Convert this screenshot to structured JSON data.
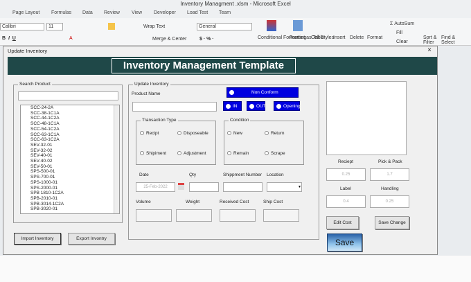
{
  "window": {
    "title": "Inventory Managment .xlsm - Microsoft Excel"
  },
  "menu": [
    "Page Layout",
    "Formulas",
    "Data",
    "Review",
    "View",
    "Developer",
    "Load Test",
    "Team"
  ],
  "ribbon": {
    "font": "Calibri",
    "size": "11",
    "wrap_text": "Wrap Text",
    "merge_center": "Merge & Center",
    "number_format": "General",
    "conditional": "Conditional Formatting",
    "format_table": "Format as Table",
    "cell_styles": "Cell Styles",
    "insert": "Insert",
    "delete": "Delete",
    "format": "Format",
    "autosum": "AutoSum",
    "fill": "Fill",
    "clear": "Clear",
    "sort_filter": "Sort & Filter",
    "find_select": "Find & Select"
  },
  "dialog": {
    "title": "Update Inventory",
    "close": "×",
    "banner": "Inventory Management Template",
    "search": {
      "label": "Search Product",
      "value": "",
      "items": [
        "SCC-24-2A",
        "SCC-38-1C1A",
        "SCC-44-1C2A",
        "SCC-48-1C1A",
        "SCC-54-1C2A",
        "SCC-63-1C1A",
        "SCC-63-1C2A",
        "SEV-32-01",
        "SEV-32-02",
        "SEV-40-01",
        "SEV-40-02",
        "SEV-50-01",
        "SPS-500-01",
        "SPS-700-01",
        "SPS-1000-01",
        "SPS-2000-01",
        "SPB 1810-1C2A",
        "SPB-2010-01",
        "SPB-3014-1C2A",
        "SPB-3020-01"
      ]
    },
    "import": "Import Inventory",
    "export": "Export Invontry",
    "update": {
      "label": "Update Inventory",
      "product_name": "Product Name",
      "non_conform": "Non Conform",
      "in": "IN",
      "out": "OUT",
      "opening": "Opening",
      "transaction": {
        "label": "Transaction Type",
        "options": [
          "Recipt",
          "Disposeable",
          "Shipiment",
          "Adjustment"
        ]
      },
      "condition": {
        "label": "Condition",
        "options": [
          "New",
          "Return",
          "Remain",
          "Scrape"
        ]
      },
      "date": "Date",
      "date_value": "25-Feb-2022",
      "qty": "Qty",
      "shipment": "Shippment Number",
      "location": "Location",
      "volume": "Volume",
      "weight": "Weight",
      "received_cost": "Received Cost",
      "ship_cost": "Ship Cost"
    },
    "costs": {
      "receipt": "Reciept",
      "receipt_v": "0.25",
      "pick": "Pick & Pack",
      "pick_v": "1.7",
      "label": "Label",
      "label_v": "0.4",
      "handling": "Handling",
      "handling_v": "0.25"
    },
    "edit_cost": "Edit Cost",
    "save_change": "Save Change",
    "save": "Save"
  }
}
